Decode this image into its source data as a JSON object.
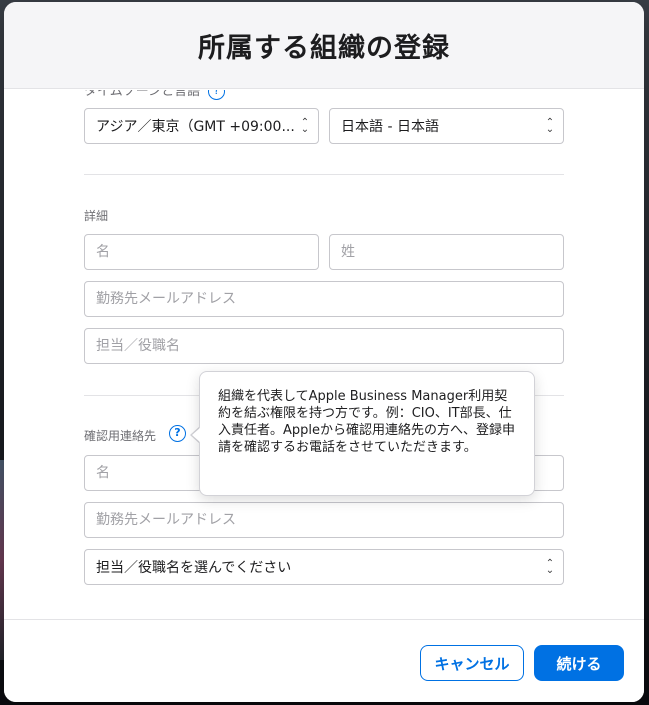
{
  "dialog": {
    "title": "所属する組織の登録"
  },
  "locale": {
    "clipped_label": "タイムゾーンと言語",
    "timezone_value": "アジア／東京（GMT +09:00...",
    "language_value": "日本語 - 日本語"
  },
  "details": {
    "section_label": "詳細",
    "first_name_placeholder": "名",
    "last_name_placeholder": "姓",
    "email_placeholder": "勤務先メールアドレス",
    "job_title_placeholder": "担当／役職名"
  },
  "verification_contact": {
    "section_label": "確認用連絡先",
    "help_icon_glyph": "?",
    "first_name_placeholder": "名",
    "email_placeholder": "勤務先メールアドレス",
    "job_title_select_value": "担当／役職名を選んでください"
  },
  "tooltip": {
    "text": "組織を代表してApple Business Manager利用契約を結ぶ権限を持つ方です。例：CIO、IT部長、仕入責任者。Appleから確認用連絡先の方へ、登録申請を確認するお電話をさせていただきます。"
  },
  "footer": {
    "cancel_label": "キャンセル",
    "continue_label": "続ける"
  },
  "colors": {
    "accent": "#0071e3",
    "header_bg": "#f5f5f7",
    "border": "#c7c7cc"
  },
  "icons": {
    "select_chevron": "chevron-up-down-icon",
    "help": "question-circle-icon"
  }
}
